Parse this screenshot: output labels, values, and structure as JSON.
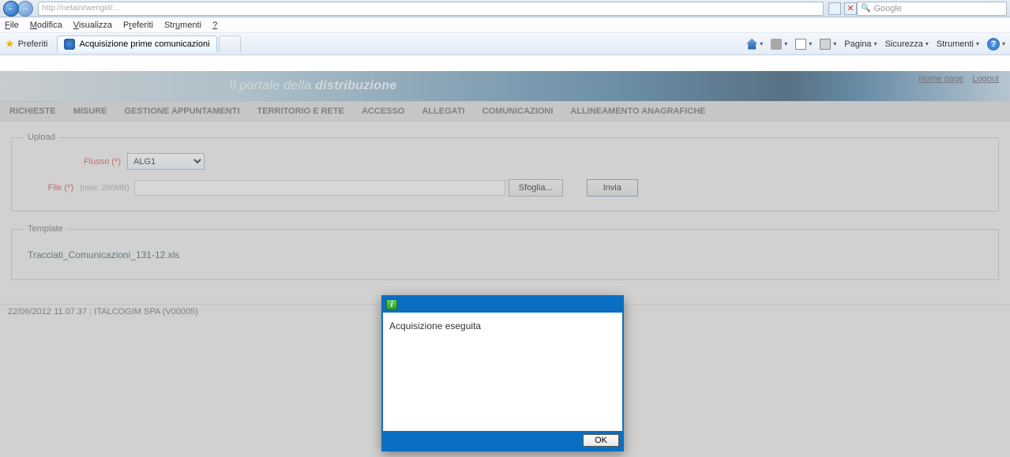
{
  "browser": {
    "menu": [
      "File",
      "Modifica",
      "Visualizza",
      "Preferiti",
      "Strumenti",
      "?"
    ],
    "fav_label": "Preferiti",
    "tab_title": "Acquisizione prime comunicazioni",
    "search_placeholder": "Google",
    "toolbar": {
      "pagina": "Pagina",
      "sicurezza": "Sicurezza",
      "strumenti": "Strumenti"
    }
  },
  "page": {
    "links": {
      "home": "Home page",
      "logout": "Logout"
    },
    "banner_italic": "Il portale della ",
    "banner_bold": "distribuzione",
    "nav": [
      "RICHIESTE",
      "MISURE",
      "GESTIONE APPUNTAMENTI",
      "TERRITORIO E RETE",
      "ACCESSO",
      "ALLEGATI",
      "COMUNICAZIONI",
      "ALLINEAMENTO ANAGRAFICHE"
    ],
    "upload": {
      "legend": "Upload",
      "flusso_label": "Flusso (*)",
      "flusso_value": "ALG1",
      "file_label": "File (*)",
      "file_hint": "(max. 200MB)",
      "browse": "Sfoglia...",
      "submit": "Invia"
    },
    "template": {
      "legend": "Template",
      "link": "Tracciati_Comunicazioni_131-12.xls"
    },
    "status": "22/06/2012 11.07.37  :   ITALCOGIM SPA   (V00005)"
  },
  "dialog": {
    "message": "Acquisizione eseguita",
    "ok": "OK"
  }
}
